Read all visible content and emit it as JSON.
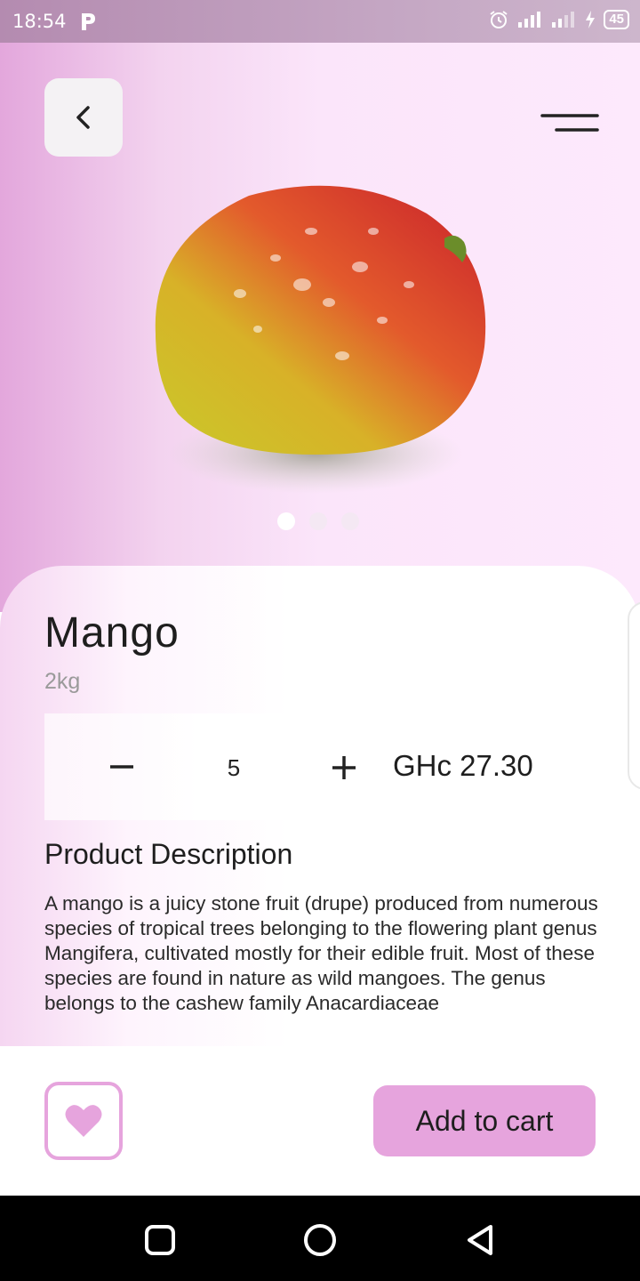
{
  "status_bar": {
    "time": "18:54",
    "battery": "45"
  },
  "header": {
    "back_icon": "chevron-left-icon",
    "menu_icon": "menu-icon"
  },
  "carousel": {
    "image": "mango",
    "dots": 3,
    "active_index": 0
  },
  "product": {
    "name": "Mango",
    "weight": "2kg",
    "quantity": "5",
    "price": "GHc 27.30",
    "description_title": "Product Description",
    "description": "A mango is a juicy stone fruit (drupe) produced from numerous species of tropical trees belonging to the flowering plant genus Mangifera, cultivated mostly for their edible fruit. Most of these species are found in nature as wild mangoes. The genus belongs to the cashew family Anacardiaceae"
  },
  "actions": {
    "favorite_icon": "heart-icon",
    "add_to_cart": "Add to cart"
  },
  "colors": {
    "accent": "#e6a4dd",
    "hero_left": "#e3a7dc",
    "hero_right": "#fde9fc"
  }
}
